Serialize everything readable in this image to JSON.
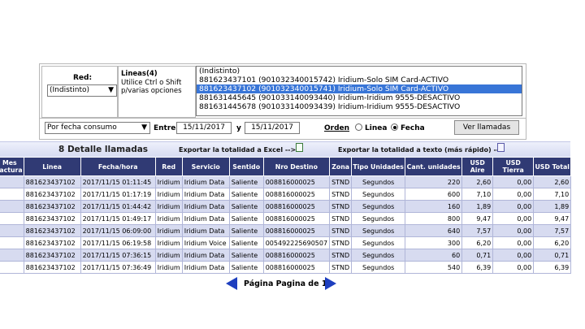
{
  "filters": {
    "red_label": "Red:",
    "red_value": "(Indistinto)",
    "lineas_title": "Lineas(4)",
    "lineas_hint": "Utilice Ctrl o Shift p/varias opciones",
    "lineas_options": [
      "(Indistinto)",
      "881623437101 (901032340015742) Iridium-Solo SIM Card-ACTIVO",
      "881623437102 (901032340015741) Iridium-Solo SIM Card-ACTIVO",
      "881631445645 (901033140093440) Iridium-Iridium 9555-DESACTIVO",
      "881631445678 (901033140093439) Iridium-Iridium 9555-DESACTIVO"
    ],
    "selected_index": 2,
    "order_select": "Por fecha consumo",
    "entre_label": "Entre",
    "date_from": "15/11/2017",
    "y_label": "y",
    "date_to": "15/11/2017",
    "orden_label": "Orden",
    "radio_linea": "Linea",
    "radio_fecha": "Fecha",
    "ver_button": "Ver llamadas"
  },
  "bar": {
    "title": "8 Detalle llamadas",
    "export_excel": "Exportar la totalidad a Excel -->",
    "export_text": "Exportar la totalidad a texto (más rápido) -->"
  },
  "table": {
    "headers": [
      "Mes factura",
      "Linea",
      "Fecha/hora",
      "Red",
      "Servicio",
      "Sentido",
      "Nro Destino",
      "Zona",
      "Tipo Unidades",
      "Cant. unidades",
      "USD Aire",
      "USD Tierra",
      "USD Total"
    ],
    "rows": [
      [
        "",
        "881623437102",
        "2017/11/15 01:11:45",
        "Iridium",
        "Iridium Data",
        "Saliente",
        "008816000025",
        "STND",
        "Segundos",
        "220",
        "2,60",
        "0,00",
        "2,60"
      ],
      [
        "",
        "881623437102",
        "2017/11/15 01:17:19",
        "Iridium",
        "Iridium Data",
        "Saliente",
        "008816000025",
        "STND",
        "Segundos",
        "600",
        "7,10",
        "0,00",
        "7,10"
      ],
      [
        "",
        "881623437102",
        "2017/11/15 01:44:42",
        "Iridium",
        "Iridium Data",
        "Saliente",
        "008816000025",
        "STND",
        "Segundos",
        "160",
        "1,89",
        "0,00",
        "1,89"
      ],
      [
        "",
        "881623437102",
        "2017/11/15 01:49:17",
        "Iridium",
        "Iridium Data",
        "Saliente",
        "008816000025",
        "STND",
        "Segundos",
        "800",
        "9,47",
        "0,00",
        "9,47"
      ],
      [
        "",
        "881623437102",
        "2017/11/15 06:09:00",
        "Iridium",
        "Iridium Data",
        "Saliente",
        "008816000025",
        "STND",
        "Segundos",
        "640",
        "7,57",
        "0,00",
        "7,57"
      ],
      [
        "",
        "881623437102",
        "2017/11/15 06:19:58",
        "Iridium",
        "Iridium Voice",
        "Saliente",
        "005492225690507",
        "STND",
        "Segundos",
        "300",
        "6,20",
        "0,00",
        "6,20"
      ],
      [
        "",
        "881623437102",
        "2017/11/15 07:36:15",
        "Iridium",
        "Iridium Data",
        "Saliente",
        "008816000025",
        "STND",
        "Segundos",
        "60",
        "0,71",
        "0,00",
        "0,71"
      ],
      [
        "",
        "881623437102",
        "2017/11/15 07:36:49",
        "Iridium",
        "Iridium Data",
        "Saliente",
        "008816000025",
        "STND",
        "Segundos",
        "540",
        "6,39",
        "0,00",
        "6,39"
      ]
    ]
  },
  "pager": {
    "text": "Página Pagina de 1"
  },
  "icons": {
    "excel": "excel-export-icon",
    "text": "text-export-icon",
    "prev": "prev-page-arrow-icon",
    "next": "next-page-arrow-icon"
  }
}
